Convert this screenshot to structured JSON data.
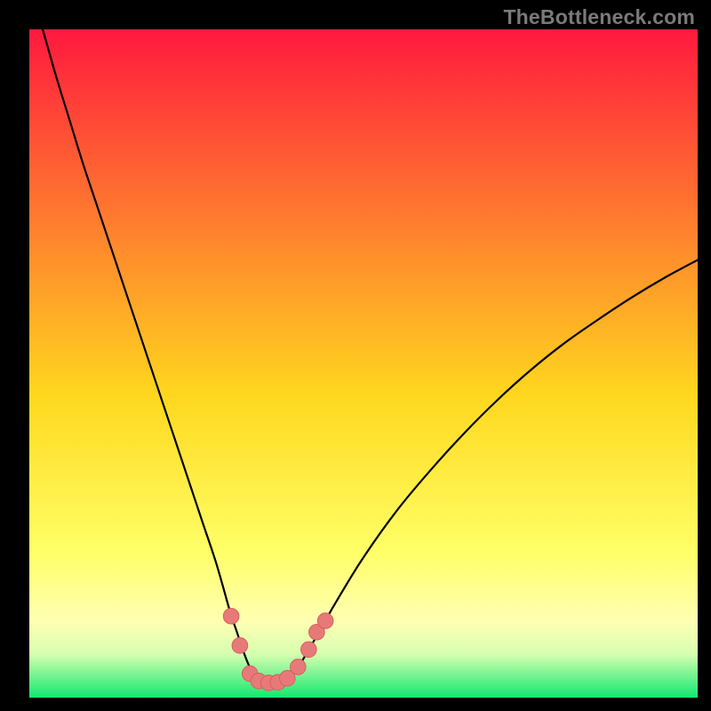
{
  "watermark": "TheBottleneck.com",
  "colors": {
    "frame": "#000000",
    "gradient_top": "#ff193e",
    "gradient_mid_upper": "#ff7a2f",
    "gradient_mid": "#ffd81e",
    "gradient_lower": "#ffff66",
    "gradient_yellowwhite": "#ffffb3",
    "gradient_pale": "#d6ffb0",
    "gradient_green": "#12e86f",
    "curve": "#000000",
    "marker_fill": "#e77a79",
    "marker_stroke": "#d85f5e"
  },
  "gradient_stops": [
    {
      "offset": 0.0,
      "key": "gradient_top"
    },
    {
      "offset": 0.28,
      "key": "gradient_mid_upper"
    },
    {
      "offset": 0.55,
      "key": "gradient_mid"
    },
    {
      "offset": 0.78,
      "key": "gradient_lower"
    },
    {
      "offset": 0.885,
      "key": "gradient_yellowwhite"
    },
    {
      "offset": 0.935,
      "key": "gradient_pale"
    },
    {
      "offset": 1.0,
      "key": "gradient_green"
    }
  ],
  "chart_data": {
    "type": "line",
    "title": "",
    "xlabel": "",
    "ylabel": "",
    "xlim": [
      0,
      100
    ],
    "ylim": [
      0,
      100
    ],
    "series": [
      {
        "name": "bottleneck-curve",
        "x": [
          0,
          2,
          4,
          6,
          8,
          10,
          12,
          14,
          16,
          18,
          20,
          22,
          24,
          26,
          28,
          30,
          31,
          32,
          33,
          34,
          35,
          36,
          37,
          38,
          39,
          40,
          42,
          44,
          46,
          50,
          55,
          60,
          65,
          70,
          75,
          80,
          85,
          90,
          95,
          100
        ],
        "y": [
          107,
          100,
          93,
          86.5,
          80,
          74,
          68,
          62,
          56,
          50,
          44,
          38,
          32,
          26,
          20,
          13,
          10,
          7,
          4.5,
          3,
          2.2,
          2,
          2,
          2.3,
          3,
          4.2,
          7.5,
          11,
          14.5,
          21,
          28,
          34,
          39.5,
          44.5,
          49,
          53,
          56.5,
          59.8,
          62.8,
          65.5
        ]
      }
    ],
    "markers": {
      "name": "highlight-points",
      "points": [
        {
          "x": 30.2,
          "y": 12.2
        },
        {
          "x": 31.5,
          "y": 7.8
        },
        {
          "x": 33.0,
          "y": 3.6
        },
        {
          "x": 34.3,
          "y": 2.5
        },
        {
          "x": 35.8,
          "y": 2.2
        },
        {
          "x": 37.2,
          "y": 2.3
        },
        {
          "x": 38.6,
          "y": 2.9
        },
        {
          "x": 40.2,
          "y": 4.6
        },
        {
          "x": 41.8,
          "y": 7.2
        },
        {
          "x": 43.0,
          "y": 9.8
        },
        {
          "x": 44.3,
          "y": 11.5
        }
      ]
    }
  }
}
